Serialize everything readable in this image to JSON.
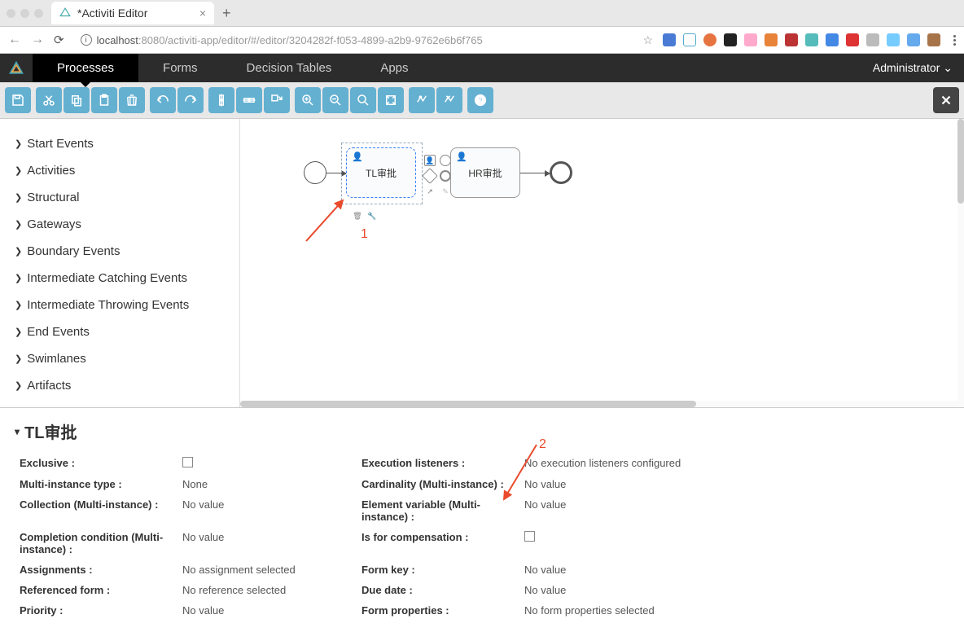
{
  "browser": {
    "tab_title": "*Activiti Editor",
    "url_host": "localhost",
    "url_port": ":8080",
    "url_path": "/activiti-app/editor/#/editor/3204282f-f053-4899-a2b9-9762e6b6f765"
  },
  "header": {
    "tabs": [
      "Processes",
      "Forms",
      "Decision Tables",
      "Apps"
    ],
    "active_tab": 0,
    "user": "Administrator"
  },
  "palette": {
    "groups": [
      "Start Events",
      "Activities",
      "Structural",
      "Gateways",
      "Boundary Events",
      "Intermediate Catching Events",
      "Intermediate Throwing Events",
      "End Events",
      "Swimlanes",
      "Artifacts"
    ]
  },
  "canvas": {
    "task1": "TL审批",
    "task2": "HR审批",
    "annotation1": "1",
    "annotation2": "2"
  },
  "properties": {
    "title": "TL审批",
    "rows": [
      {
        "l": "Exclusive :",
        "v_type": "checkbox",
        "r": "Execution listeners :",
        "rv": "No execution listeners configured"
      },
      {
        "l": "Multi-instance type :",
        "v": "None",
        "r": "Cardinality (Multi-instance) :",
        "rv": "No value"
      },
      {
        "l": "Collection (Multi-instance) :",
        "v": "No value",
        "r": "Element variable (Multi-instance) :",
        "rv": "No value"
      },
      {
        "l": "Completion condition (Multi-instance) :",
        "v": "No value",
        "r": "Is for compensation :",
        "rv_type": "checkbox"
      },
      {
        "l": "Assignments :",
        "v": "No assignment selected",
        "r": "Form key :",
        "rv": "No value"
      },
      {
        "l": "Referenced form :",
        "v": "No reference selected",
        "r": "Due date :",
        "rv": "No value"
      },
      {
        "l": "Priority :",
        "v": "No value",
        "r": "Form properties :",
        "rv": "No form properties selected"
      }
    ]
  }
}
